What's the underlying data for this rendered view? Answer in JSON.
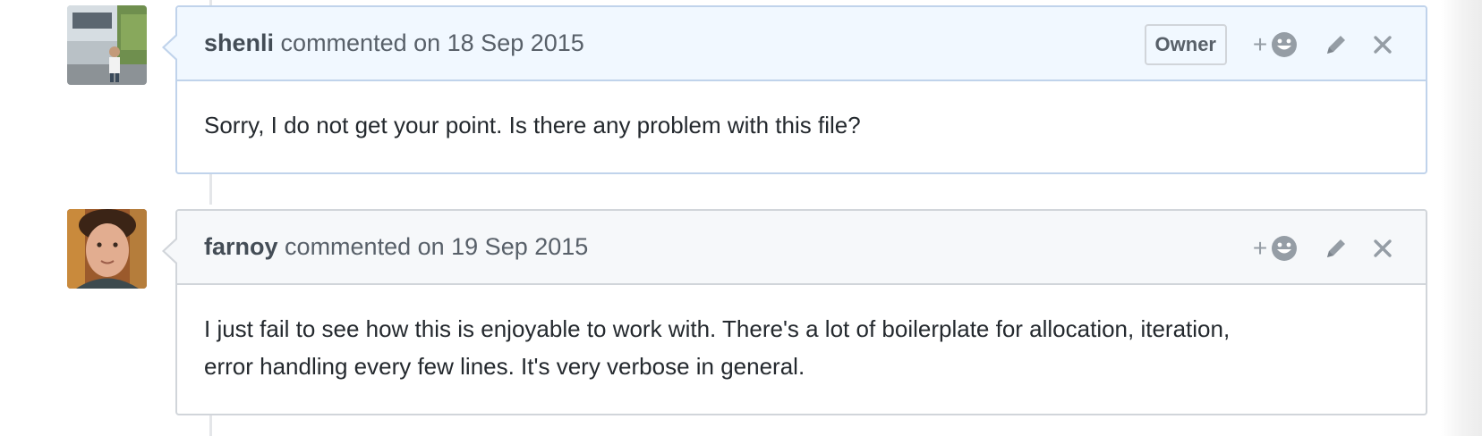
{
  "comments": [
    {
      "author": "shenli",
      "meta": "commented on 18 Sep 2015",
      "badge": "Owner",
      "body": [
        "Sorry, I do not get your point. Is there any problem with this file?"
      ],
      "avatar_icon": "photo-avatar-fifa"
    },
    {
      "author": "farnoy",
      "meta": "commented on 19 Sep 2015",
      "badge": "",
      "body": [
        "I just fail to see how this is enjoyable to work with. There's a lot of boilerplate for allocation, iteration,",
        "error handling every few lines. It's very verbose in general."
      ],
      "avatar_icon": "photo-avatar-face"
    }
  ],
  "icons": {
    "reaction_plus": "+",
    "reaction": "smiley-icon",
    "edit": "pencil-icon",
    "delete": "close-icon"
  },
  "colors": {
    "owner_header_bg": "#f1f8ff",
    "owner_border": "#c0d3eb",
    "default_header_bg": "#f6f8fa",
    "default_border": "#d1d5da",
    "icon_gray": "#959da5"
  }
}
